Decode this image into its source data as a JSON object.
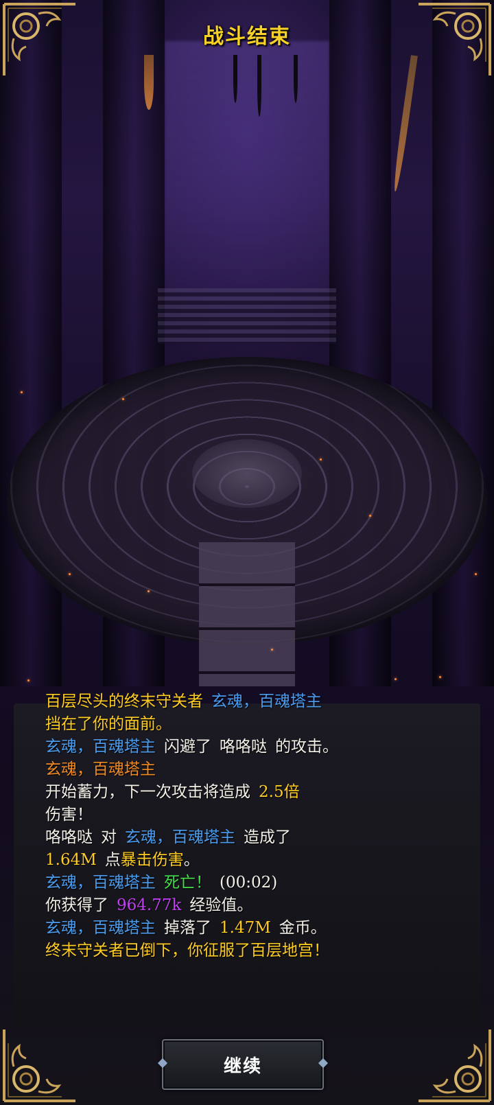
{
  "header": {
    "title": "战斗结束"
  },
  "battle_log": [
    {
      "segments": [
        {
          "text": "百层尽头的终末守关者",
          "color": "yellow"
        },
        {
          "text": "玄魂，百魂塔主",
          "color": "blue"
        }
      ]
    },
    {
      "segments": [
        {
          "text": "挡在了你的面前。",
          "color": "yellow"
        }
      ]
    },
    {
      "segments": [
        {
          "text": "玄魂，百魂塔主",
          "color": "blue"
        },
        {
          "text": "闪避了",
          "color": "white"
        },
        {
          "text": "咯咯哒",
          "color": "white"
        },
        {
          "text": "的攻击。",
          "color": "white"
        }
      ]
    },
    {
      "segments": [
        {
          "text": "玄魂，百魂塔主",
          "color": "orange"
        }
      ]
    },
    {
      "segments": [
        {
          "text": "开始蓄力，下一次攻击将造成",
          "color": "white"
        },
        {
          "text": "2.5倍",
          "color": "yellow"
        }
      ]
    },
    {
      "segments": [
        {
          "text": "伤害！",
          "color": "white"
        }
      ]
    },
    {
      "segments": [
        {
          "text": "咯咯哒",
          "color": "white"
        },
        {
          "text": "对",
          "color": "white"
        },
        {
          "text": "玄魂，百魂塔主",
          "color": "blue"
        },
        {
          "text": "造成了",
          "color": "white"
        }
      ]
    },
    {
      "segments": [
        {
          "text": "1.64M",
          "color": "yellow"
        },
        {
          "text": "点",
          "color": "white"
        },
        {
          "text": "暴击伤害",
          "color": "yellow"
        },
        {
          "text": "。",
          "color": "white"
        }
      ]
    },
    {
      "segments": [
        {
          "text": "玄魂，百魂塔主",
          "color": "blue"
        },
        {
          "text": "死亡！",
          "color": "green"
        },
        {
          "text": "(00:02)",
          "color": "white"
        }
      ]
    },
    {
      "segments": [
        {
          "text": "你获得了",
          "color": "white"
        },
        {
          "text": "964.77k",
          "color": "purple"
        },
        {
          "text": "经验值。",
          "color": "white"
        }
      ]
    },
    {
      "segments": [
        {
          "text": "玄魂，百魂塔主",
          "color": "blue"
        },
        {
          "text": "掉落了",
          "color": "white"
        },
        {
          "text": "1.47M",
          "color": "yellow"
        },
        {
          "text": "金币。",
          "color": "white"
        }
      ]
    },
    {
      "segments": [
        {
          "text": "终末守关者已倒下，你征服了百层地宫！",
          "color": "yellow"
        }
      ]
    }
  ],
  "footer": {
    "continue_label": "继续"
  },
  "colors": {
    "title": "#f7d028",
    "yellow": "#ffcc22",
    "blue": "#4a9df0",
    "orange": "#f08a22",
    "white": "#f4f0e8",
    "green": "#44e04a",
    "purple": "#c040f0"
  }
}
